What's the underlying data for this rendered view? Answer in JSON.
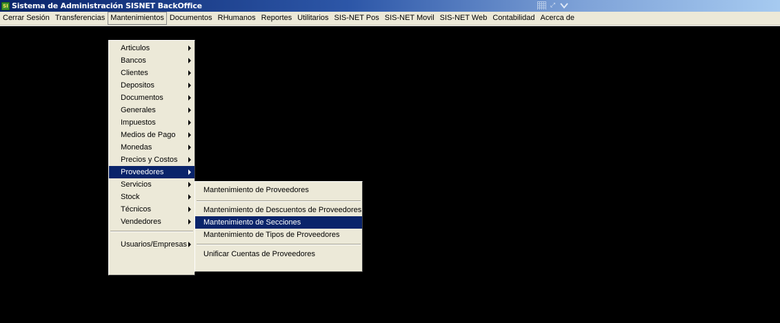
{
  "window": {
    "title": "Sistema de Administración SISNET BackOffice",
    "icon": "sisnet-app-icon",
    "icon_glyph": "SI"
  },
  "menubar": {
    "items": [
      {
        "label": "Cerrar Sesión"
      },
      {
        "label": "Transferencias"
      },
      {
        "label": "Mantenimientos",
        "active": true
      },
      {
        "label": "Documentos"
      },
      {
        "label": "RHumanos"
      },
      {
        "label": "Reportes"
      },
      {
        "label": "Utilitarios"
      },
      {
        "label": "SIS-NET Pos"
      },
      {
        "label": "SIS-NET Movil"
      },
      {
        "label": "SIS-NET Web"
      },
      {
        "label": "Contabilidad"
      },
      {
        "label": "Acerca de"
      }
    ]
  },
  "mantenimientos_menu": {
    "items": [
      {
        "label": "Articulos"
      },
      {
        "label": "Bancos"
      },
      {
        "label": "Clientes"
      },
      {
        "label": "Depositos"
      },
      {
        "label": "Documentos"
      },
      {
        "label": "Generales"
      },
      {
        "label": "Impuestos"
      },
      {
        "label": "Medios de Pago"
      },
      {
        "label": "Monedas"
      },
      {
        "label": "Precios y Costos"
      },
      {
        "label": "Proveedores",
        "highlighted": true
      },
      {
        "label": "Servicios"
      },
      {
        "label": "Stock"
      },
      {
        "label": "Técnicos"
      },
      {
        "label": "Vendedores"
      },
      {
        "label": "Usuarios/Empresas"
      }
    ]
  },
  "proveedores_submenu": {
    "items": [
      {
        "label": "Mantenimiento de Proveedores"
      },
      {
        "label": "Mantenimiento de Descuentos de Proveedores"
      },
      {
        "label": "Mantenimiento de Secciones",
        "highlighted": true
      },
      {
        "label": "Mantenimiento de Tipos de Proveedores"
      },
      {
        "label": "Unificar Cuentas de Proveedores"
      }
    ]
  },
  "colors": {
    "titlebar_start": "#0a246a",
    "titlebar_end": "#a6caf0",
    "menu_bg": "#ece9d8",
    "highlight": "#0a246a",
    "workspace": "#000000"
  }
}
